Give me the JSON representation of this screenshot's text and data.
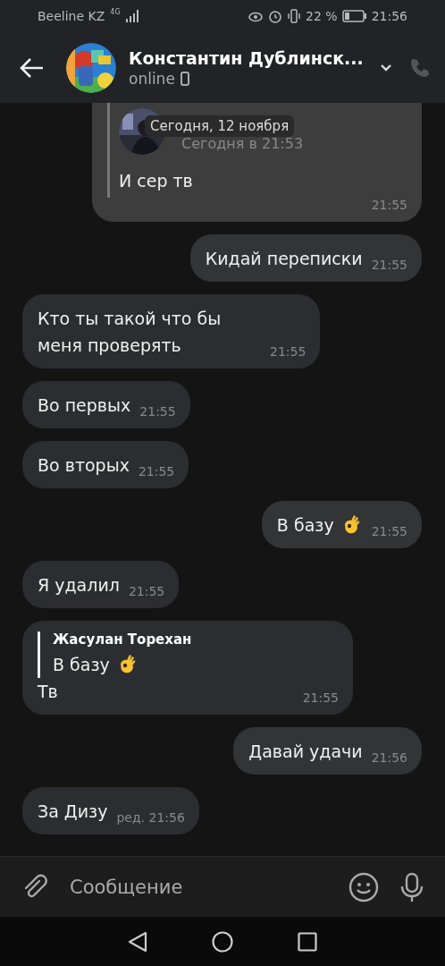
{
  "status_bar": {
    "carrier": "Beeline KZ",
    "network": "4G",
    "battery": "22 %",
    "time": "21:56"
  },
  "header": {
    "name": "Константин Дублинск...",
    "status": "online"
  },
  "date_badge": "Сегодня, 12 ноября",
  "messages": [
    {
      "kind": "forwarded",
      "outgoing": true,
      "forward_time": "Сегодня в 21:53",
      "text": "И сер тв",
      "time": "21:55"
    },
    {
      "kind": "text",
      "outgoing": true,
      "text": "Кидай переписки",
      "time": "21:55"
    },
    {
      "kind": "text",
      "outgoing": false,
      "text": "Кто ты такой что бы меня проверять",
      "time": "21:55"
    },
    {
      "kind": "text",
      "outgoing": false,
      "text": "Во первых",
      "time": "21:55"
    },
    {
      "kind": "text",
      "outgoing": false,
      "text": "Во вторых",
      "time": "21:55"
    },
    {
      "kind": "text",
      "outgoing": true,
      "text": "В базу",
      "ok_hand_emoji": true,
      "time": "21:55"
    },
    {
      "kind": "text",
      "outgoing": false,
      "text": "Я удалил",
      "time": "21:55"
    },
    {
      "kind": "reply",
      "outgoing": false,
      "reply_author": "Жасулан Торехан",
      "reply_text": "В базу",
      "reply_ok_hand_emoji": true,
      "text": "Тв",
      "time": "21:55"
    },
    {
      "kind": "text",
      "outgoing": true,
      "text": "Давай удачи",
      "time": "21:56"
    },
    {
      "kind": "text",
      "outgoing": false,
      "text": "За Дизу",
      "time": "ред. 21:56"
    }
  ],
  "composer": {
    "placeholder": "Сообщение"
  }
}
